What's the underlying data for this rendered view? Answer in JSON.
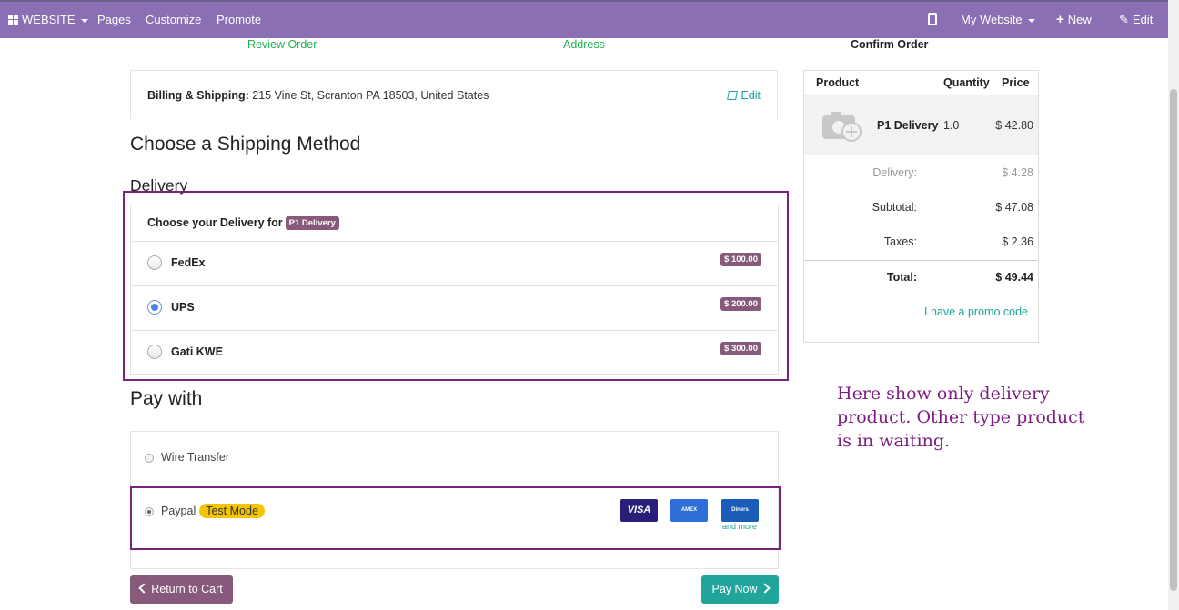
{
  "topbar": {
    "website": "WEBSITE",
    "pages": "Pages",
    "customize": "Customize",
    "promote": "Promote",
    "my_website": "My Website",
    "new": "New",
    "edit": "Edit"
  },
  "steps": [
    "Review Order",
    "Address",
    "Confirm Order"
  ],
  "billing": {
    "label": "Billing & Shipping:",
    "address": "215 Vine St, Scranton PA 18503, United States",
    "edit": "Edit"
  },
  "headings": {
    "shipping": "Choose a Shipping Method",
    "delivery": "Delivery",
    "pay": "Pay with"
  },
  "delivery": {
    "choose_label": "Choose your Delivery for",
    "product_badge": "P1 Delivery",
    "options": [
      {
        "name": "FedEx",
        "price": "$ 100.00",
        "selected": false
      },
      {
        "name": "UPS",
        "price": "$ 200.00",
        "selected": true
      },
      {
        "name": "Gati KWE",
        "price": "$ 300.00",
        "selected": false
      }
    ]
  },
  "payment": {
    "wire": "Wire Transfer",
    "paypal": "Paypal",
    "test_mode": "Test Mode",
    "cards": [
      "VISA",
      "AMEX",
      "Diners"
    ],
    "and_more": "and more"
  },
  "buttons": {
    "return": "Return to Cart",
    "pay_now": "Pay Now"
  },
  "summary": {
    "headers": {
      "product": "Product",
      "quantity": "Quantity",
      "price": "Price"
    },
    "item": {
      "name": "P1 Delivery",
      "qty": "1.0",
      "price": "$ 42.80"
    },
    "delivery_label": "Delivery:",
    "delivery_value": "$ 4.28",
    "subtotal_label": "Subtotal:",
    "subtotal_value": "$ 47.08",
    "taxes_label": "Taxes:",
    "taxes_value": "$ 2.36",
    "total_label": "Total:",
    "total_value": "$ 49.44",
    "promo": "I have a promo code"
  },
  "annotation": "Here show only delivery product. Other type product is in waiting.",
  "colors": {
    "topbar": "#8a6fb4",
    "accent": "#875a7b",
    "teal": "#21a59b",
    "annotation": "#7c1e82"
  }
}
